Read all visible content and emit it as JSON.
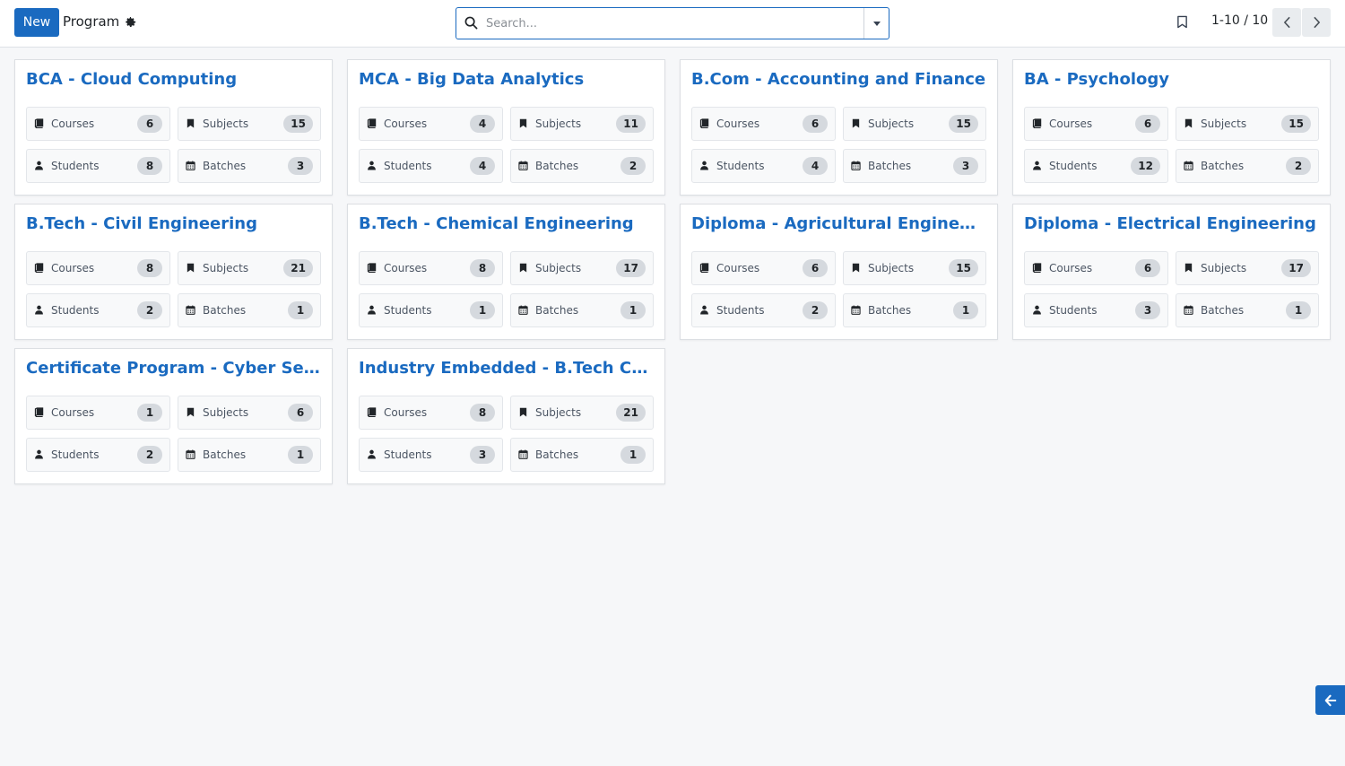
{
  "header": {
    "new_label": "New",
    "breadcrumb": "Program",
    "search_placeholder": "Search...",
    "pager": "1-10 / 10"
  },
  "icons": {
    "courses": "book-icon",
    "subjects": "bookmark-icon",
    "students": "user-icon",
    "batches": "calendar-icon"
  },
  "colors": {
    "accent": "#1a6ac0"
  },
  "programs": [
    {
      "title": "BCA - Cloud Computing",
      "stats": [
        {
          "label": "Courses",
          "count": "6"
        },
        {
          "label": "Subjects",
          "count": "15"
        },
        {
          "label": "Students",
          "count": "8"
        },
        {
          "label": "Batches",
          "count": "3"
        }
      ]
    },
    {
      "title": "MCA - Big Data Analytics",
      "stats": [
        {
          "label": "Courses",
          "count": "4"
        },
        {
          "label": "Subjects",
          "count": "11"
        },
        {
          "label": "Students",
          "count": "4"
        },
        {
          "label": "Batches",
          "count": "2"
        }
      ]
    },
    {
      "title": "B.Com - Accounting and Finance",
      "stats": [
        {
          "label": "Courses",
          "count": "6"
        },
        {
          "label": "Subjects",
          "count": "15"
        },
        {
          "label": "Students",
          "count": "4"
        },
        {
          "label": "Batches",
          "count": "3"
        }
      ]
    },
    {
      "title": "BA - Psychology",
      "stats": [
        {
          "label": "Courses",
          "count": "6"
        },
        {
          "label": "Subjects",
          "count": "15"
        },
        {
          "label": "Students",
          "count": "12"
        },
        {
          "label": "Batches",
          "count": "2"
        }
      ]
    },
    {
      "title": "B.Tech - Civil Engineering",
      "stats": [
        {
          "label": "Courses",
          "count": "8"
        },
        {
          "label": "Subjects",
          "count": "21"
        },
        {
          "label": "Students",
          "count": "2"
        },
        {
          "label": "Batches",
          "count": "1"
        }
      ]
    },
    {
      "title": "B.Tech - Chemical Engineering",
      "stats": [
        {
          "label": "Courses",
          "count": "8"
        },
        {
          "label": "Subjects",
          "count": "17"
        },
        {
          "label": "Students",
          "count": "1"
        },
        {
          "label": "Batches",
          "count": "1"
        }
      ]
    },
    {
      "title": "Diploma - Agricultural Engineering",
      "stats": [
        {
          "label": "Courses",
          "count": "6"
        },
        {
          "label": "Subjects",
          "count": "15"
        },
        {
          "label": "Students",
          "count": "2"
        },
        {
          "label": "Batches",
          "count": "1"
        }
      ]
    },
    {
      "title": "Diploma - Electrical Engineering",
      "stats": [
        {
          "label": "Courses",
          "count": "6"
        },
        {
          "label": "Subjects",
          "count": "17"
        },
        {
          "label": "Students",
          "count": "3"
        },
        {
          "label": "Batches",
          "count": "1"
        }
      ]
    },
    {
      "title": "Certificate Program - Cyber Security",
      "stats": [
        {
          "label": "Courses",
          "count": "1"
        },
        {
          "label": "Subjects",
          "count": "6"
        },
        {
          "label": "Students",
          "count": "2"
        },
        {
          "label": "Batches",
          "count": "1"
        }
      ]
    },
    {
      "title": "Industry Embedded - B.Tech CSE",
      "stats": [
        {
          "label": "Courses",
          "count": "8"
        },
        {
          "label": "Subjects",
          "count": "21"
        },
        {
          "label": "Students",
          "count": "3"
        },
        {
          "label": "Batches",
          "count": "1"
        }
      ]
    }
  ]
}
